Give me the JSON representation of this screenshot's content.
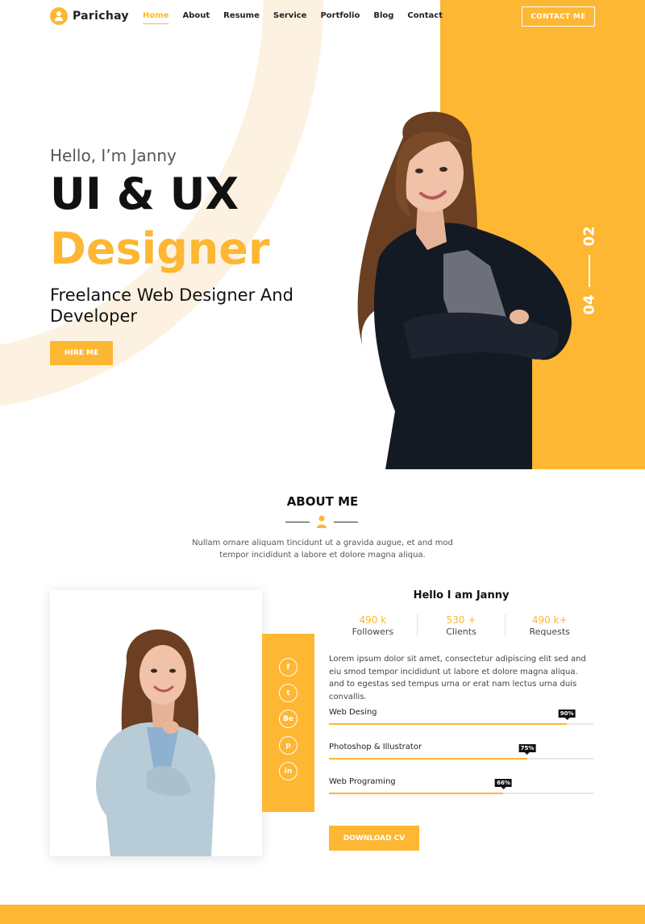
{
  "brand": {
    "name": "Parichay",
    "accent": "#fdb733"
  },
  "nav": {
    "items": [
      {
        "label": "Home",
        "active": true
      },
      {
        "label": "About"
      },
      {
        "label": "Resume"
      },
      {
        "label": "Service"
      },
      {
        "label": "Portfolio"
      },
      {
        "label": "Blog"
      },
      {
        "label": "Contact"
      }
    ],
    "contact_button": "CONTACT ME"
  },
  "hero": {
    "greeting": "Hello, I’m Janny",
    "role_line1": "UI & UX",
    "role_line2": "Designer",
    "subtitle": "Freelance Web Designer And Developer",
    "hire_button": "HIRE ME",
    "slide_current": "02",
    "slide_total": "04"
  },
  "about": {
    "title": "ABOUT ME",
    "description": "Nullam ornare aliquam tincidunt ut a gravida augue, et and mod tempor incididunt a labore et dolore magna aliqua.",
    "greeting": "Hello I am Janny",
    "stats": [
      {
        "value": "490 k",
        "label": "Followers"
      },
      {
        "value": "530 +",
        "label": "Clients"
      },
      {
        "value": "490 k+",
        "label": "Requests"
      }
    ],
    "body": "Lorem ipsum dolor sit amet, consectetur adipiscing elit sed and eiu smod tempor incididunt ut labore et dolore magna aliqua. and to egestas sed tempus urna or erat nam lectus urna duis convallis.",
    "skills": [
      {
        "name": "Web Desing",
        "percent": 90,
        "label": "90%"
      },
      {
        "name": "Photoshop & Illustrator",
        "percent": 75,
        "label": "75%"
      },
      {
        "name": "Web Programing",
        "percent": 66,
        "label": "66%"
      }
    ],
    "download_button": "DOWNLOAD CV",
    "social": [
      {
        "icon": "facebook-icon",
        "glyph": "f"
      },
      {
        "icon": "twitter-icon",
        "glyph": "t"
      },
      {
        "icon": "behance-icon",
        "glyph": "Be"
      },
      {
        "icon": "pinterest-icon",
        "glyph": "p"
      },
      {
        "icon": "linkedin-icon",
        "glyph": "in"
      }
    ]
  }
}
